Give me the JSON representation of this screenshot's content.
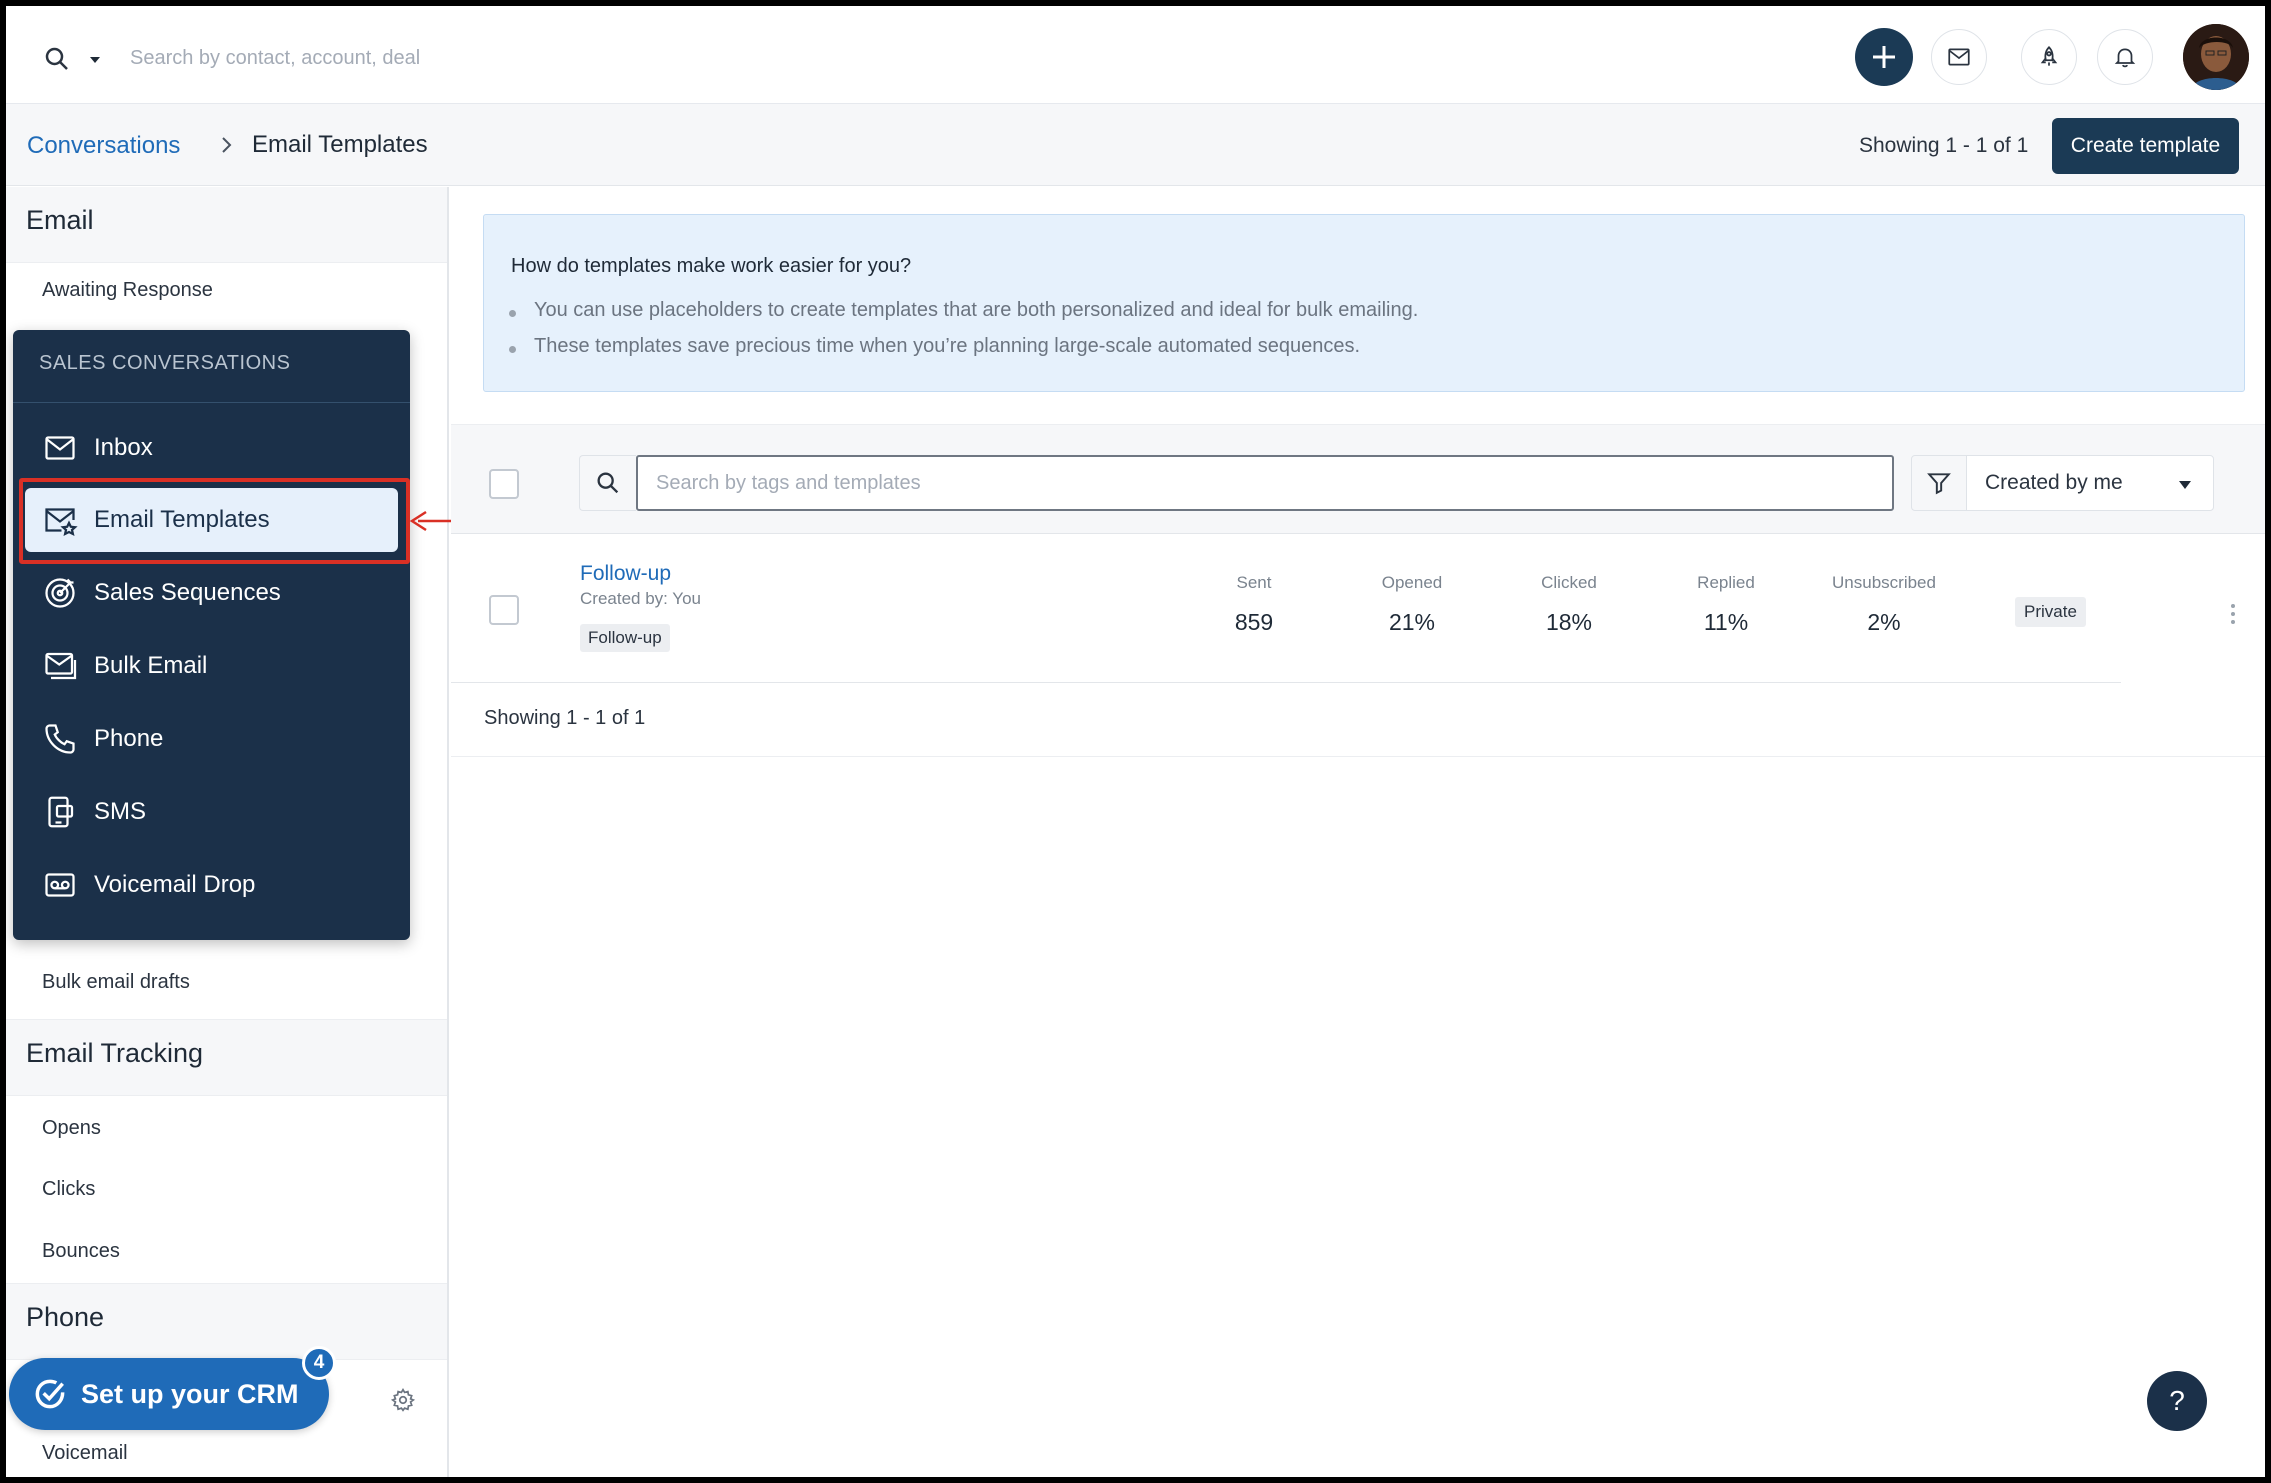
{
  "topbar": {
    "search_placeholder": "Search by contact, account, deal",
    "icons": [
      "search-icon",
      "chevron-down-icon",
      "plus-icon",
      "mail-icon",
      "rocket-icon",
      "bell-icon",
      "avatar"
    ]
  },
  "breadcrumb": {
    "parent": "Conversations",
    "current": "Email Templates"
  },
  "header": {
    "showing": "Showing 1 - 1 of 1",
    "create_button": "Create template"
  },
  "sidebar": {
    "email_heading": "Email",
    "awaiting_response": "Awaiting Response",
    "bulk_email_drafts": "Bulk email drafts",
    "tracking_heading": "Email Tracking",
    "tracking_items": [
      "Opens",
      "Clicks",
      "Bounces"
    ],
    "phone_heading": "Phone",
    "voicemail": "Voicemail"
  },
  "sales_menu": {
    "title": "SALES CONVERSATIONS",
    "items": [
      {
        "label": "Inbox",
        "icon": "mail-icon"
      },
      {
        "label": "Email Templates",
        "icon": "mail-star-icon",
        "active": true
      },
      {
        "label": "Sales Sequences",
        "icon": "target-icon"
      },
      {
        "label": "Bulk Email",
        "icon": "bulk-mail-icon"
      },
      {
        "label": "Phone",
        "icon": "phone-icon"
      },
      {
        "label": "SMS",
        "icon": "sms-icon"
      },
      {
        "label": "Voicemail Drop",
        "icon": "voicemail-icon"
      }
    ]
  },
  "setup_crm": {
    "label": "Set up your CRM",
    "badge": "4"
  },
  "info": {
    "title": "How do templates make work easier for you?",
    "bullets": [
      "You can use placeholders to create templates that are both personalized and ideal for bulk emailing.",
      "These templates save precious time when you’re planning large-scale automated sequences."
    ]
  },
  "toolbar": {
    "search_placeholder": "Search by tags and templates",
    "filter_value": "Created by me"
  },
  "templates": [
    {
      "name": "Follow-up",
      "created_by": "Created by: You",
      "tag": "Follow-up",
      "stats": [
        {
          "label": "Sent",
          "value": "859"
        },
        {
          "label": "Opened",
          "value": "21%"
        },
        {
          "label": "Clicked",
          "value": "18%"
        },
        {
          "label": "Replied",
          "value": "11%"
        },
        {
          "label": "Unsubscribed",
          "value": "2%"
        }
      ],
      "visibility": "Private"
    }
  ],
  "footer": {
    "showing": "Showing 1 - 1 of 1"
  },
  "help": "?",
  "colors": {
    "navy": "#1b3049",
    "accent_blue": "#1f6bb8",
    "highlight_red": "#d93025",
    "info_bg": "#e6f1fc"
  }
}
